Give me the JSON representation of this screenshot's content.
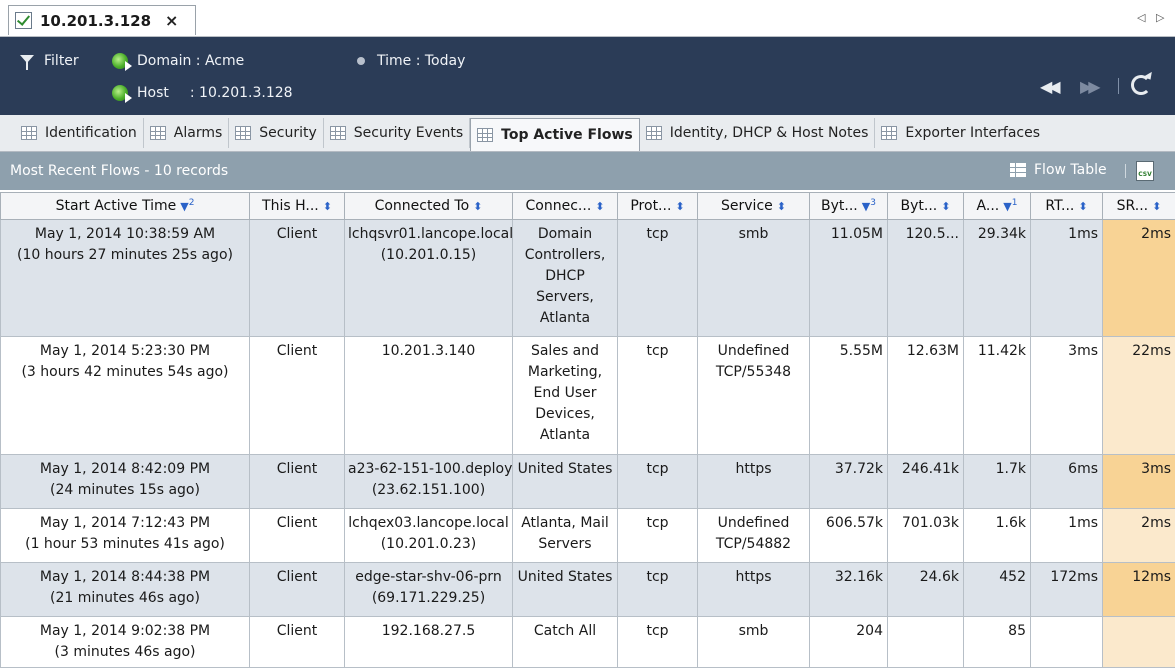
{
  "window": {
    "tab_label": "10.201.3.128",
    "tab_close": "×",
    "scroll_left": "◁",
    "scroll_right": "▷"
  },
  "filter": {
    "filter_label": "Filter",
    "domain_label": "Domain : Acme",
    "time_label": "Time : Today",
    "host_label": "Host",
    "host_value": ": 10.201.3.128",
    "rewind": "◀◀",
    "forward": "▶▶"
  },
  "tabs": [
    {
      "label": "Identification"
    },
    {
      "label": "Alarms"
    },
    {
      "label": "Security"
    },
    {
      "label": "Security Events"
    },
    {
      "label": "Top Active Flows"
    },
    {
      "label": "Identity, DHCP & Host Notes"
    },
    {
      "label": "Exporter Interfaces"
    }
  ],
  "section": {
    "title": "Most Recent Flows - 10 records",
    "flow_table": "Flow Table",
    "csv": "CSV"
  },
  "columns": [
    {
      "label": "Start Active Time",
      "sort": "▼",
      "order": "2"
    },
    {
      "label": "This H...",
      "sort": "⬍",
      "order": ""
    },
    {
      "label": "Connected To",
      "sort": "⬍",
      "order": ""
    },
    {
      "label": "Connec...",
      "sort": "⬍",
      "order": ""
    },
    {
      "label": "Prot...",
      "sort": "⬍",
      "order": ""
    },
    {
      "label": "Service",
      "sort": "⬍",
      "order": ""
    },
    {
      "label": "Byt...",
      "sort": "▼",
      "order": "3"
    },
    {
      "label": "Byt...",
      "sort": "⬍",
      "order": ""
    },
    {
      "label": "A...",
      "sort": "▼",
      "order": "1"
    },
    {
      "label": "RT...",
      "sort": "⬍",
      "order": ""
    },
    {
      "label": "SR...",
      "sort": "⬍",
      "order": ""
    }
  ],
  "rows": [
    {
      "start": "May 1, 2014 10:38:59 AM",
      "ago": "(10 hours 27 minutes 25s ago)",
      "this_host": "Client",
      "connected": "lchqsvr01.lancope.local",
      "connected_ip": "(10.201.0.15)",
      "conn_group": "Domain Controllers, DHCP Servers, Atlanta",
      "protocol": "tcp",
      "service": "smb",
      "bytes1": "11.05M",
      "bytes2": "120.5...",
      "a": "29.34k",
      "rtt": "1ms",
      "srt": "2ms"
    },
    {
      "start": "May 1, 2014 5:23:30 PM",
      "ago": "(3 hours 42 minutes 54s ago)",
      "this_host": "Client",
      "connected": "10.201.3.140",
      "connected_ip": "",
      "conn_group": "Sales and Marketing, End User Devices, Atlanta",
      "protocol": "tcp",
      "service": "Undefined TCP/55348",
      "bytes1": "5.55M",
      "bytes2": "12.63M",
      "a": "11.42k",
      "rtt": "3ms",
      "srt": "22ms"
    },
    {
      "start": "May 1, 2014 8:42:09 PM",
      "ago": "(24 minutes 15s ago)",
      "this_host": "Client",
      "connected": "a23-62-151-100.deploy",
      "connected_ip": "(23.62.151.100)",
      "conn_group": "United States",
      "protocol": "tcp",
      "service": "https",
      "bytes1": "37.72k",
      "bytes2": "246.41k",
      "a": "1.7k",
      "rtt": "6ms",
      "srt": "3ms"
    },
    {
      "start": "May 1, 2014 7:12:43 PM",
      "ago": "(1 hour 53 minutes 41s ago)",
      "this_host": "Client",
      "connected": "lchqex03.lancope.local",
      "connected_ip": "(10.201.0.23)",
      "conn_group": "Atlanta, Mail Servers",
      "protocol": "tcp",
      "service": "Undefined TCP/54882",
      "bytes1": "606.57k",
      "bytes2": "701.03k",
      "a": "1.6k",
      "rtt": "1ms",
      "srt": "2ms"
    },
    {
      "start": "May 1, 2014 8:44:38 PM",
      "ago": "(21 minutes 46s ago)",
      "this_host": "Client",
      "connected": "edge-star-shv-06-prn",
      "connected_ip": "(69.171.229.25)",
      "conn_group": "United States",
      "protocol": "tcp",
      "service": "https",
      "bytes1": "32.16k",
      "bytes2": "24.6k",
      "a": "452",
      "rtt": "172ms",
      "srt": "12ms"
    },
    {
      "start": "May 1, 2014 9:02:38 PM",
      "ago": "(3 minutes 46s ago)",
      "this_host": "Client",
      "connected": "192.168.27.5",
      "connected_ip": "",
      "conn_group": "Catch All",
      "protocol": "tcp",
      "service": "smb",
      "bytes1": "204",
      "bytes2": "",
      "a": "85",
      "rtt": "",
      "srt": ""
    }
  ]
}
